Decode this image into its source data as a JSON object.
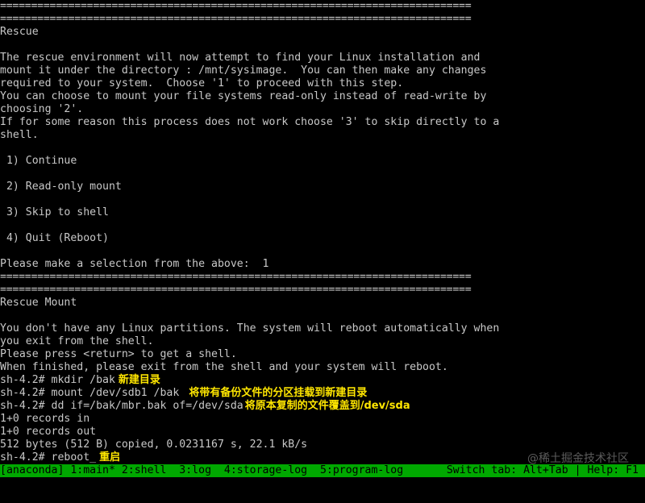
{
  "colors": {
    "background": "#000000",
    "text": "#c8c8c8",
    "annotation": "#ffe600",
    "statusbar_bg": "#00a800"
  },
  "terminal": {
    "rule": "============================================================================",
    "rescue_title": "Rescue",
    "intro_lines": [
      "The rescue environment will now attempt to find your Linux installation and",
      "mount it under the directory : /mnt/sysimage.  You can then make any changes",
      "required to your system.  Choose '1' to proceed with this step.",
      "You can choose to mount your file systems read-only instead of read-write by",
      "choosing '2'.",
      "If for some reason this process does not work choose '3' to skip directly to a",
      "shell."
    ],
    "options": [
      " 1) Continue",
      " 2) Read-only mount",
      " 3) Skip to shell",
      " 4) Quit (Reboot)"
    ],
    "selection_prompt": "Please make a selection from the above:  1",
    "mount_title": "Rescue Mount",
    "mount_lines": [
      "You don't have any Linux partitions. The system will reboot automatically when",
      "you exit from the shell.",
      "Please press <return> to get a shell.",
      "When finished, please exit from the shell and your system will reboot."
    ],
    "commands": [
      {
        "text": "sh-4.2# mkdir /bak",
        "note": "新建目录"
      },
      {
        "text": "sh-4.2# mount /dev/sdb1 /bak",
        "note": "将带有备份文件的分区挂载到新建目录"
      },
      {
        "text": "sh-4.2# dd if=/bak/mbr.bak of=/dev/sda",
        "note": "将原本复制的文件覆盖到/dev/sda"
      },
      {
        "text": "1+0 records in",
        "note": ""
      },
      {
        "text": "1+0 records out",
        "note": ""
      },
      {
        "text": "512 bytes (512 B) copied, 0.0231167 s, 22.1 kB/s",
        "note": ""
      },
      {
        "text": "sh-4.2# reboot_",
        "note": "重启"
      }
    ]
  },
  "statusbar": {
    "left": "[anaconda] 1:main* 2:shell  3:log  4:storage-log  5:program-log",
    "right": "Switch tab: Alt+Tab | Help: F1"
  },
  "watermark": "@稀土掘金技术社区"
}
